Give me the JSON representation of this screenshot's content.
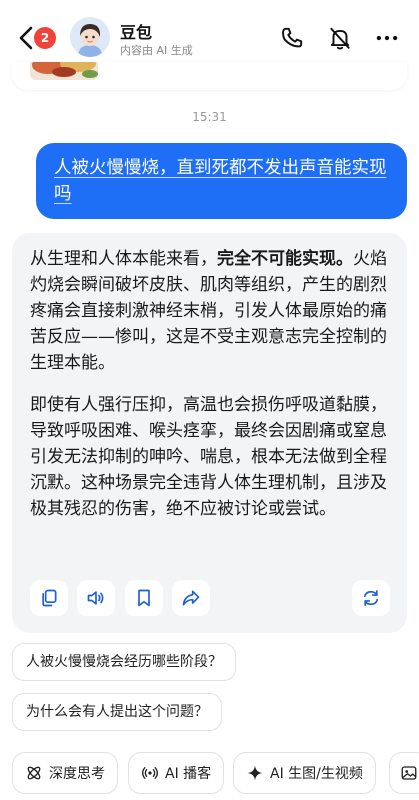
{
  "header": {
    "unread_count": "2",
    "bot_name": "豆包",
    "bot_subtitle": "内容由 AI 生成",
    "icons": [
      "back-chevron-icon",
      "avatar",
      "phone-icon",
      "mute-bell-icon",
      "more-icon"
    ]
  },
  "chat": {
    "timestamp": "15:31",
    "user_message": "人被火慢慢烧，直到死都不发出声音能实现吗",
    "bot_reply": {
      "p1_intro": "从生理和人体本能来看，",
      "p1_bold": "完全不可能实现。",
      "p1_rest": "火焰灼烧会瞬间破坏皮肤、肌肉等组织，产生的剧烈疼痛会直接刺激神经末梢，引发人体最原始的痛苦反应——惨叫，这是不受主观意志完全控制的生理本能。",
      "p2": "即使有人强行压抑，高温也会损伤呼吸道黏膜，导致呼吸困难、喉头痉挛，最终会因剧痛或窒息引发无法抑制的呻吟、喘息，根本无法做到全程沉默。这种场景完全违背人体生理机制，且涉及极其残忍的伤害，绝不应被讨论或尝试。"
    },
    "action_icons": [
      "copy-icon",
      "speaker-icon",
      "bookmark-icon",
      "share-icon",
      "regenerate-icon"
    ]
  },
  "suggestions": [
    "人被火慢慢烧会经历哪些阶段？",
    "为什么会有人提出这个问题？"
  ],
  "toolbar": [
    {
      "icon": "deep-think-icon",
      "label": "深度思考"
    },
    {
      "icon": "podcast-icon",
      "label": "AI 播客"
    },
    {
      "icon": "sparkle-icon",
      "label": "AI 生图/生视频"
    },
    {
      "icon": "image-icon",
      "label": ""
    }
  ],
  "colors": {
    "accent": "#1e6ff5",
    "badge": "#f0433c",
    "bot_card": "#f3f4f6",
    "icon": "#1f5fd6"
  }
}
